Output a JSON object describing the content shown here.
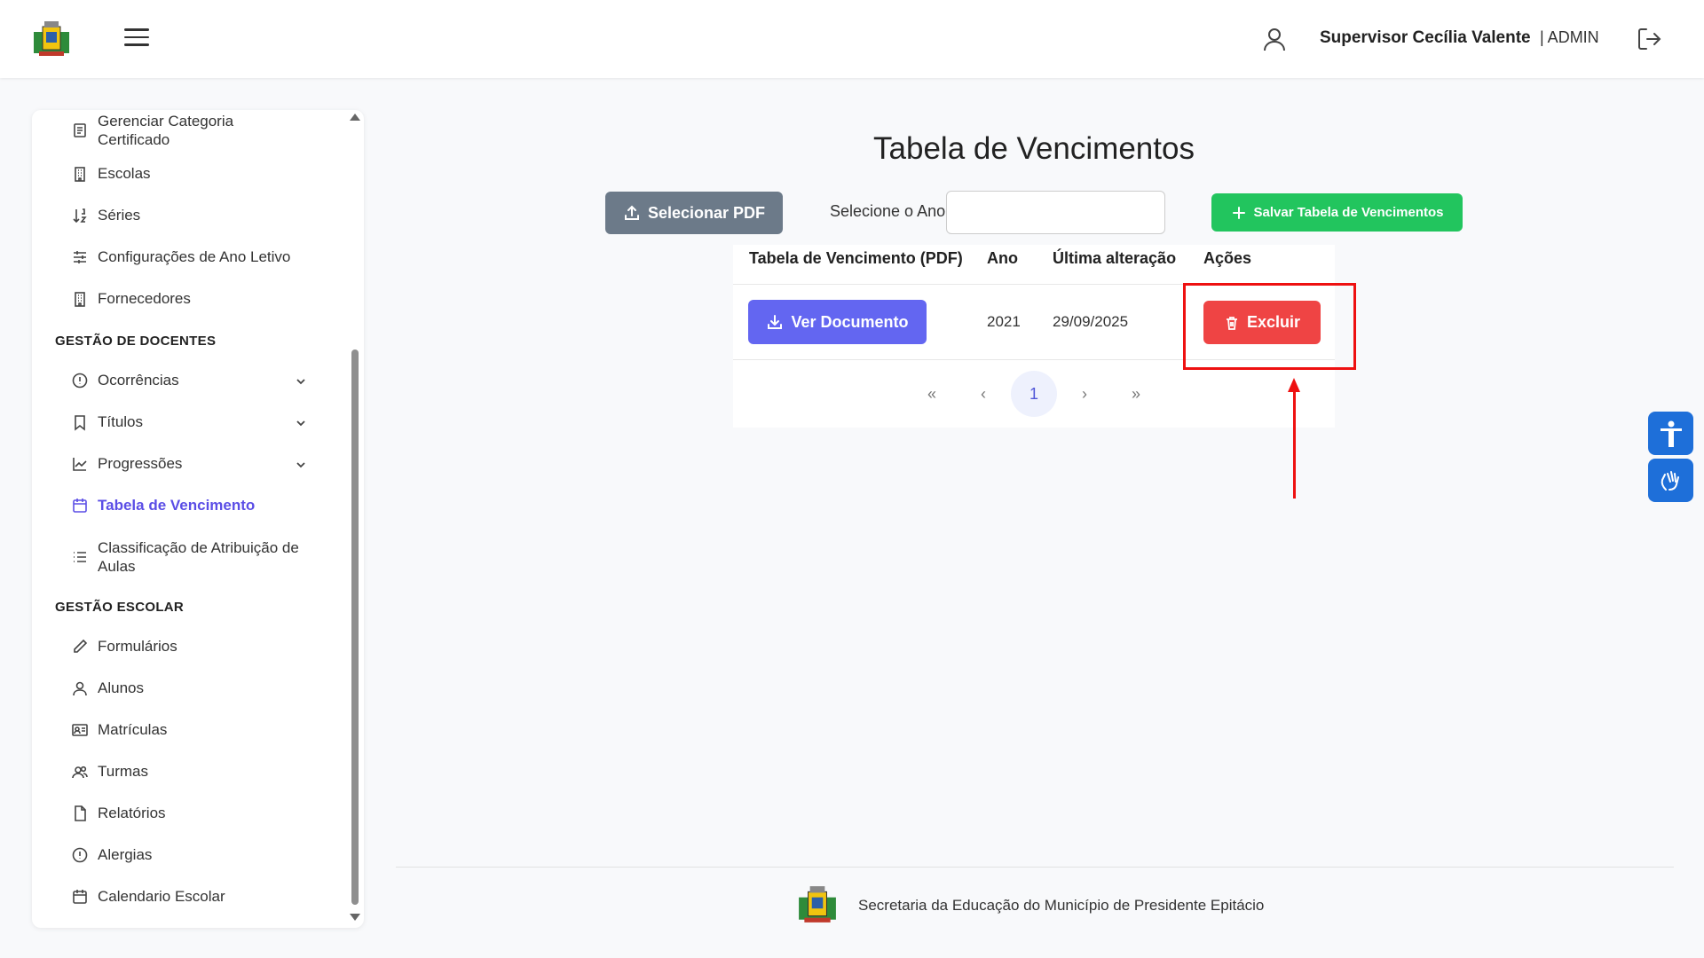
{
  "header": {
    "user_name": "Supervisor Cecília Valente",
    "user_role": "| ADMIN"
  },
  "sidebar": {
    "items_top": [
      {
        "label_line1": "Gerenciar Categoria",
        "label_line2": "Certificado"
      },
      {
        "label": "Escolas"
      },
      {
        "label": "Séries"
      },
      {
        "label": "Configurações de Ano Letivo"
      },
      {
        "label": "Fornecedores"
      }
    ],
    "section_docentes": "GESTÃO DE DOCENTES",
    "items_docentes": [
      {
        "label": "Ocorrências"
      },
      {
        "label": "Títulos"
      },
      {
        "label": "Progressões"
      },
      {
        "label": "Tabela de Vencimento"
      },
      {
        "label_line1": "Classificação de Atribuição de",
        "label_line2": "Aulas"
      }
    ],
    "section_escolar": "GESTÃO ESCOLAR",
    "items_escolar": [
      {
        "label": "Formulários"
      },
      {
        "label": "Alunos"
      },
      {
        "label": "Matrículas"
      },
      {
        "label": "Turmas"
      },
      {
        "label": "Relatórios"
      },
      {
        "label": "Alergias"
      },
      {
        "label": "Calendario Escolar"
      }
    ]
  },
  "main": {
    "title": "Tabela de Vencimentos",
    "select_pdf_label": "Selecionar PDF",
    "year_label": "Selecione o Ano:",
    "year_value": "",
    "save_label": "Salvar Tabela de Vencimentos",
    "columns": [
      "Tabela de Vencimento (PDF)",
      "Ano",
      "Última alteração",
      "Ações"
    ],
    "rows": [
      {
        "view_label": "Ver Documento",
        "year": "2021",
        "updated": "29/09/2025",
        "delete_label": "Excluir"
      }
    ],
    "pagination": {
      "first": "«",
      "prev": "‹",
      "current": "1",
      "next": "›",
      "last": "»"
    }
  },
  "footer": {
    "text": "Secretaria da Educação do Município de Presidente Epitácio"
  },
  "colors": {
    "accent": "#6366f1",
    "success": "#22c55e",
    "danger": "#ef4444",
    "secondary": "#6c7a89",
    "annotation": "#ee1111"
  }
}
